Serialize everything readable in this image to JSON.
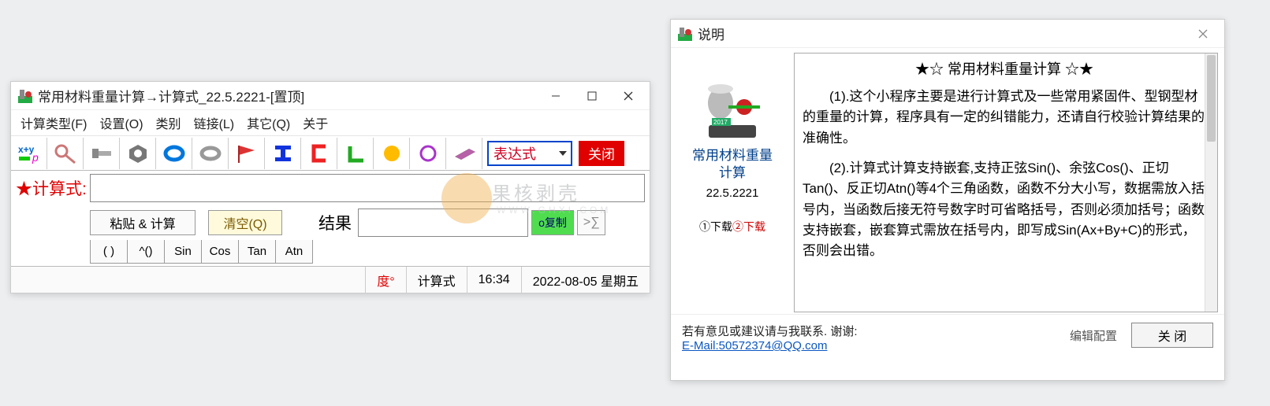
{
  "main": {
    "title": "常用材料重量计算→计算式_22.5.2221-[置顶]",
    "menu": [
      "计算类型(F)",
      "设置(O)",
      "类别",
      "链接(L)",
      "其它(Q)",
      "关于"
    ],
    "toolbar_icons": [
      "formula-icon",
      "screw-eye-icon",
      "bolt-icon",
      "nut-icon",
      "ring-blue-icon",
      "ring-grey-icon",
      "flag-icon",
      "i-beam-icon",
      "c-channel-icon",
      "angle-icon",
      "circle-filled-icon",
      "circle-outline-icon",
      "sheet-icon"
    ],
    "expr_select": "表达式",
    "close_btn": "关闭",
    "formula_label": "★计算式:",
    "formula_value": "",
    "paste_calc": "粘贴 & 计算",
    "clear": "清空(Q)",
    "result_label": "结果",
    "result_value": "",
    "copy": "o复制",
    "sum": ">∑",
    "small_btns": [
      "( )",
      "^()",
      "Sin",
      "Cos",
      "Tan",
      "Atn"
    ],
    "status": {
      "degree": "度°",
      "mode": "计算式",
      "time": "16:34",
      "date": "2022-08-05  星期五"
    }
  },
  "help": {
    "title": "说明",
    "heading": "★☆ 常用材料重量计算 ☆★",
    "progname": "常用材料重量\n计算",
    "version": "22.5.2221",
    "download1": "①下载",
    "download2": "②下载",
    "para1": "(1).这个小程序主要是进行计算式及一些常用紧固件、型钢型材的重量的计算，程序具有一定的纠错能力，还请自行校验计算结果的准确性。",
    "para2": "(2).计算式计算支持嵌套,支持正弦Sin()、余弦Cos()、正切Tan()、反正切Atn()等4个三角函数，函数不分大小写，数据需放入括号内，当函数后接无符号数字时可省略括号，否则必须加括号；函数支持嵌套，嵌套算式需放在括号内，即写成Sin(Ax+By+C)的形式，否则会出错。",
    "contact": "若有意见或建议请与我联系. 谢谢:",
    "email": "E-Mail:50572374@QQ.com",
    "edit_cfg": "编辑配置",
    "close": "关 闭"
  },
  "watermark": {
    "text": "果核剥壳",
    "url": "WWW.GHXI.COM"
  }
}
